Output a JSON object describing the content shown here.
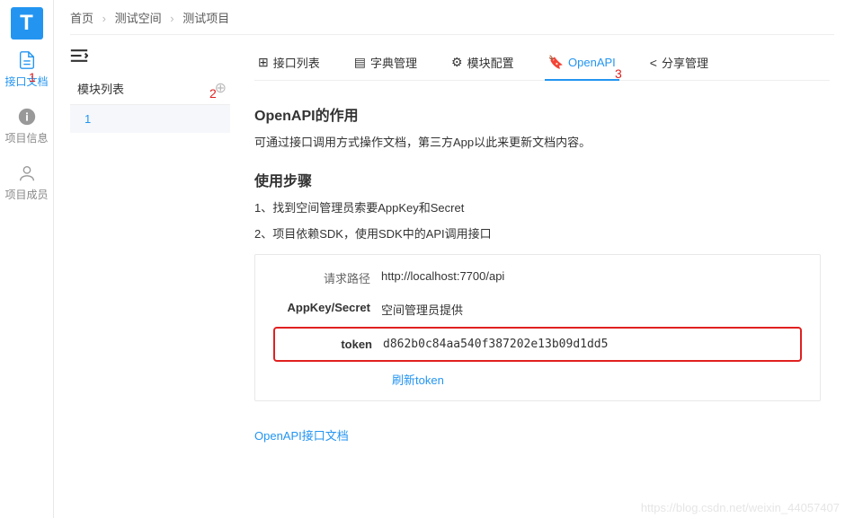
{
  "logo": "T",
  "sidebar": {
    "items": [
      {
        "label": "接口文档"
      },
      {
        "label": "项目信息"
      },
      {
        "label": "项目成员"
      }
    ]
  },
  "breadcrumb": {
    "items": [
      "首页",
      "测试空间",
      "测试项目"
    ]
  },
  "module_panel": {
    "title": "模块列表",
    "items": [
      "1"
    ]
  },
  "tabs": {
    "items": [
      {
        "label": "接口列表"
      },
      {
        "label": "字典管理"
      },
      {
        "label": "模块配置"
      },
      {
        "label": "OpenAPI"
      },
      {
        "label": "分享管理"
      }
    ]
  },
  "content": {
    "heading1": "OpenAPI的作用",
    "desc1": "可通过接口调用方式操作文档，第三方App以此来更新文档内容。",
    "heading2": "使用步骤",
    "step1": "1、找到空间管理员索要AppKey和Secret",
    "step2": "2、项目依赖SDK，使用SDK中的API调用接口",
    "info": {
      "path_label": "请求路径",
      "path_value": "http://localhost:7700/api",
      "appkey_label": "AppKey/Secret",
      "appkey_value": "空间管理员提供",
      "token_label": "token",
      "token_value": "d862b0c84aa540f387202e13b09d1dd5",
      "refresh": "刷新token"
    },
    "doc_link": "OpenAPI接口文档"
  },
  "annotations": {
    "a1": "1",
    "a2": "2",
    "a3": "3"
  },
  "watermark": "https://blog.csdn.net/weixin_44057407"
}
